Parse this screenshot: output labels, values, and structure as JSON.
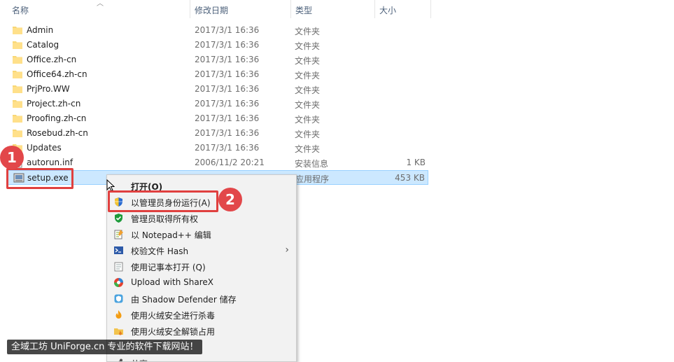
{
  "columns": {
    "name": "名称",
    "date": "修改日期",
    "type": "类型",
    "size": "大小"
  },
  "files": [
    {
      "name": "Admin",
      "date": "2017/3/1 16:36",
      "type": "文件夹",
      "size": "",
      "icon": "folder-icon"
    },
    {
      "name": "Catalog",
      "date": "2017/3/1 16:36",
      "type": "文件夹",
      "size": "",
      "icon": "folder-icon"
    },
    {
      "name": "Office.zh-cn",
      "date": "2017/3/1 16:36",
      "type": "文件夹",
      "size": "",
      "icon": "folder-icon"
    },
    {
      "name": "Office64.zh-cn",
      "date": "2017/3/1 16:36",
      "type": "文件夹",
      "size": "",
      "icon": "folder-icon"
    },
    {
      "name": "PrjPro.WW",
      "date": "2017/3/1 16:36",
      "type": "文件夹",
      "size": "",
      "icon": "folder-icon"
    },
    {
      "name": "Project.zh-cn",
      "date": "2017/3/1 16:36",
      "type": "文件夹",
      "size": "",
      "icon": "folder-icon"
    },
    {
      "name": "Proofing.zh-cn",
      "date": "2017/3/1 16:36",
      "type": "文件夹",
      "size": "",
      "icon": "folder-icon"
    },
    {
      "name": "Rosebud.zh-cn",
      "date": "2017/3/1 16:36",
      "type": "文件夹",
      "size": "",
      "icon": "folder-icon"
    },
    {
      "name": "Updates",
      "date": "2017/3/1 16:36",
      "type": "文件夹",
      "size": "",
      "icon": "folder-icon"
    },
    {
      "name": "autorun.inf",
      "date": "2006/11/2 20:21",
      "type": "安装信息",
      "size": "1 KB",
      "icon": "inf-file-icon"
    },
    {
      "name": "setup.exe",
      "date": "",
      "type": "应用程序",
      "size": "453 KB",
      "icon": "setup-exe-icon"
    }
  ],
  "markers": {
    "one": "1",
    "two": "2"
  },
  "context_menu": [
    {
      "label": "打开(O)",
      "icon": "",
      "bold": true
    },
    {
      "label": "以管理员身份运行(A)",
      "icon": "uac-shield-icon"
    },
    {
      "label": "管理员取得所有权",
      "icon": "green-shield-check-icon"
    },
    {
      "label": "以 Notepad++ 编辑",
      "icon": "notepad-plus-plus-icon"
    },
    {
      "label": "校验文件 Hash",
      "icon": "terminal-icon",
      "submenu": true
    },
    {
      "label": "使用记事本打开 (Q)",
      "icon": "notepad-icon"
    },
    {
      "label": "Upload with ShareX",
      "icon": "sharex-icon"
    },
    {
      "label": "由 Shadow Defender 储存",
      "icon": "shadow-defender-icon"
    },
    {
      "label": "使用火绒安全进行杀毒",
      "icon": "huorong-icon"
    },
    {
      "label": "使用火绒安全解锁占用",
      "icon": "huorong-unlock-icon"
    },
    {
      "label": "",
      "icon": ""
    },
    {
      "label": "共享",
      "icon": "share-icon"
    }
  ],
  "watermark": "全域工坊 UniForge.cn 专业的软件下载网站！"
}
